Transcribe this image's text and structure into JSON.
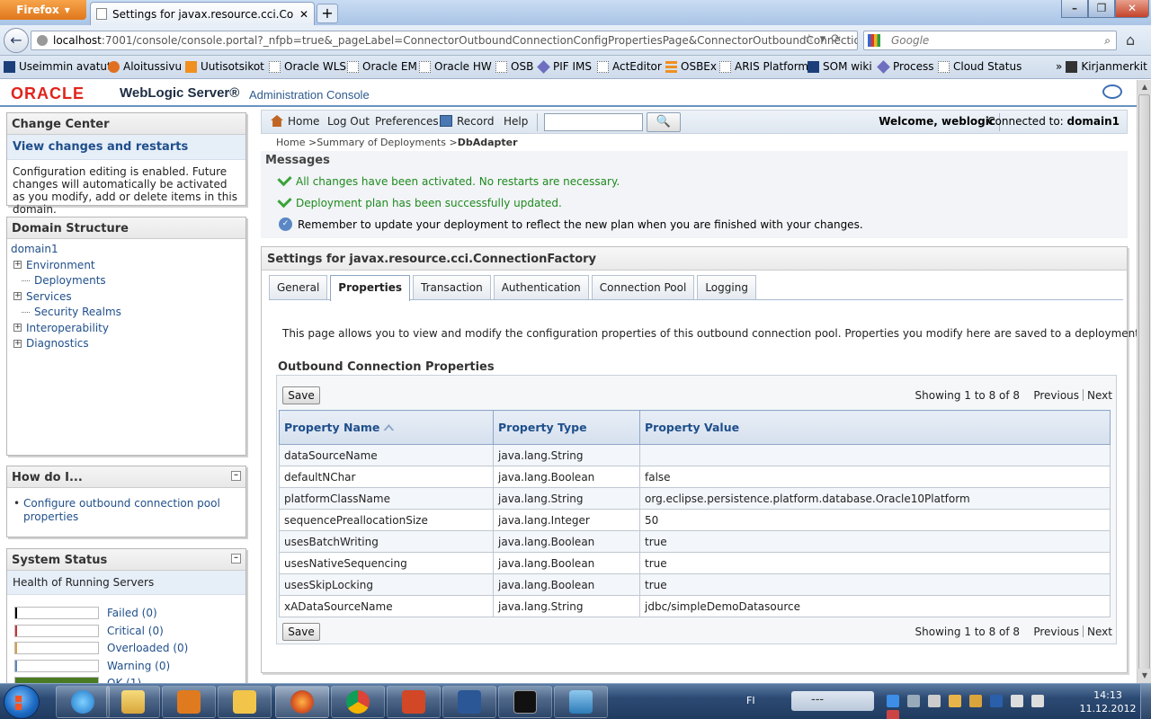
{
  "browser": {
    "menu_button": "Firefox",
    "tab_title": "Settings for javax.resource.cci.Connectio...",
    "new_tab": "+",
    "url_host": "localhost",
    "url_rest": ":7001/console/console.portal?_nfpb=true&_pageLabel=ConnectorOutboundConnectionConfigPropertiesPage&ConnectorOutboundConnectionCor",
    "search_placeholder": "Google",
    "bookmarks": [
      "Useimmin avatut",
      "Aloitussivu",
      "Uutisotsikot",
      "Oracle WLS",
      "Oracle EM",
      "Oracle HW",
      "OSB",
      "PIF IMS",
      "ActEditor",
      "OSBEx",
      "ARIS Platform",
      "SOM wiki",
      "Process",
      "Cloud Status"
    ],
    "bookmarks_more": "Kirjanmerkit"
  },
  "header": {
    "oracle": "ORACLE",
    "product": "WebLogic Server®",
    "console": "Administration Console"
  },
  "toolbar": {
    "home": "Home",
    "logout": "Log Out",
    "preferences": "Preferences",
    "record": "Record",
    "help": "Help",
    "welcome": "Welcome, weblogic",
    "connected_label": "Connected to:",
    "connected_domain": "domain1"
  },
  "breadcrumb": {
    "home": "Home",
    "summary": "Summary of Deployments",
    "current": "DbAdapter"
  },
  "change_center": {
    "title": "Change Center",
    "link": "View changes and restarts",
    "text": "Configuration editing is enabled. Future changes will automatically be activated as you modify, add or delete items in this domain."
  },
  "domain_structure": {
    "title": "Domain Structure",
    "root": "domain1",
    "items": [
      {
        "label": "Environment",
        "expandable": true
      },
      {
        "label": "Deployments",
        "expandable": false
      },
      {
        "label": "Services",
        "expandable": true
      },
      {
        "label": "Security Realms",
        "expandable": false
      },
      {
        "label": "Interoperability",
        "expandable": true
      },
      {
        "label": "Diagnostics",
        "expandable": true
      }
    ]
  },
  "how_do_i": {
    "title": "How do I...",
    "link": "Configure outbound connection pool properties"
  },
  "system_status": {
    "title": "System Status",
    "subtitle": "Health of Running Servers",
    "rows": [
      {
        "label": "Failed (0)",
        "color": "#000000",
        "fill": 0
      },
      {
        "label": "Critical (0)",
        "color": "#cc3333",
        "fill": 0
      },
      {
        "label": "Overloaded (0)",
        "color": "#d9a040",
        "fill": 0
      },
      {
        "label": "Warning (0)",
        "color": "#5a87c5",
        "fill": 0
      },
      {
        "label": "OK (1)",
        "color": "#4a7a22",
        "fill": 1
      }
    ]
  },
  "messages": {
    "title": "Messages",
    "items": [
      {
        "type": "success",
        "text": "All changes have been activated. No restarts are necessary."
      },
      {
        "type": "success",
        "text": "Deployment plan has been successfully updated."
      },
      {
        "type": "info",
        "text": "Remember to update your deployment to reflect the new plan when you are finished with your changes."
      }
    ]
  },
  "settings": {
    "title": "Settings for javax.resource.cci.ConnectionFactory",
    "tabs": [
      "General",
      "Properties",
      "Transaction",
      "Authentication",
      "Connection Pool",
      "Logging"
    ],
    "active_tab": "Properties",
    "description": "This page allows you to view and modify the configuration properties of this outbound connection pool. Properties you modify here are saved to a deployment plan.",
    "section_title": "Outbound Connection Properties",
    "save_label": "Save",
    "paging_text": "Showing 1 to 8 of 8",
    "previous": "Previous",
    "next": "Next",
    "columns": [
      "Property Name",
      "Property Type",
      "Property Value"
    ],
    "rows": [
      [
        "dataSourceName",
        "java.lang.String",
        ""
      ],
      [
        "defaultNChar",
        "java.lang.Boolean",
        "false"
      ],
      [
        "platformClassName",
        "java.lang.String",
        "org.eclipse.persistence.platform.database.Oracle10Platform"
      ],
      [
        "sequencePreallocationSize",
        "java.lang.Integer",
        "50"
      ],
      [
        "usesBatchWriting",
        "java.lang.Boolean",
        "true"
      ],
      [
        "usesNativeSequencing",
        "java.lang.Boolean",
        "true"
      ],
      [
        "usesSkipLocking",
        "java.lang.Boolean",
        "true"
      ],
      [
        "xADataSourceName",
        "java.lang.String",
        "jdbc/simpleDemoDatasource"
      ]
    ]
  },
  "taskbar": {
    "language": "FI",
    "tray_box": "---",
    "time": "14:13",
    "date": "11.12.2012"
  }
}
